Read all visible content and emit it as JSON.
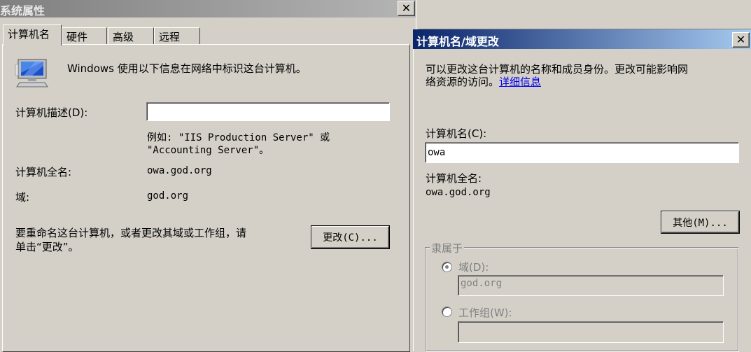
{
  "system_properties": {
    "title": "系统属性",
    "close_glyph": "✕",
    "tabs": [
      {
        "label": "计算机名"
      },
      {
        "label": "硬件"
      },
      {
        "label": "高级"
      },
      {
        "label": "远程"
      }
    ],
    "intro": "Windows 使用以下信息在网络中标识这台计算机。",
    "description_label": "计算机描述(D):",
    "description_value": "",
    "example_line1": "例如: \"IIS Production Server\" 或",
    "example_line2": "\"Accounting Server\"。",
    "full_name_label": "计算机全名:",
    "full_name_value": "owa.god.org",
    "domain_label": "域:",
    "domain_value": "god.org",
    "rename_text_line1": "要重命名这台计算机，或者更改其域或工作组，请",
    "rename_text_line2": "单击“更改”。",
    "change_button": "更改(C)..."
  },
  "rename_dialog": {
    "title": "计算机名/域更改",
    "close_glyph": "✕",
    "intro_line1": "可以更改这台计算机的名称和成员身份。更改可能影响网",
    "intro_line2": "络资源的访问。",
    "details_link": "详细信息",
    "computer_name_label": "计算机名(C):",
    "computer_name_value": "owa",
    "full_name_label": "计算机全名:",
    "full_name_value": "owa.god.org",
    "more_button": "其他(M)...",
    "member_of_legend": "隶属于",
    "domain_option_label": "域(D):",
    "domain_option_value": "god.org",
    "domain_selected": true,
    "workgroup_option_label": "工作组(W):",
    "workgroup_option_value": ""
  },
  "icons": {
    "computer": "computer-icon",
    "close": "close-icon"
  },
  "colors": {
    "dialog_face": "#d4d0c8",
    "active_title_start": "#0a246a",
    "active_title_end": "#a6caf0",
    "inactive_title": "#808080",
    "link": "#0000ee"
  }
}
